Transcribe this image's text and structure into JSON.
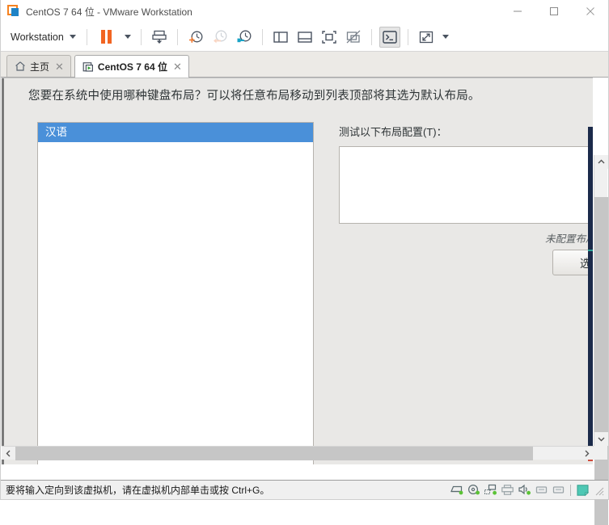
{
  "window": {
    "title": "CentOS 7 64 位 - VMware Workstation",
    "logo_icon": "vmware-logo-icon",
    "minimize_icon": "minimize-icon",
    "maximize_icon": "maximize-icon",
    "close_icon": "close-icon"
  },
  "toolbar": {
    "workstation_menu": "Workstation",
    "workstation_caret_icon": "chevron-down-icon",
    "pause_icon": "pause-icon",
    "pause_caret_icon": "chevron-down-icon",
    "send_ctrl_alt_del_icon": "send-key-icon",
    "take_snapshot_icon": "take-snapshot-icon",
    "revert_snapshot_icon": "revert-snapshot-icon",
    "snapshot_manager_icon": "snapshot-manager-icon",
    "show_sidebar_icon": "show-library-icon",
    "show_thumbnails_icon": "show-thumbnail-bar-icon",
    "fullscreen_icon": "fullscreen-icon",
    "unity_icon": "unity-mode-icon",
    "console_view_icon": "console-view-icon",
    "stretch_icon": "stretch-guest-icon",
    "stretch_caret_icon": "chevron-down-icon"
  },
  "tabs": [
    {
      "label": "主页",
      "icon": "home-icon",
      "close_icon": "close-icon",
      "active": false
    },
    {
      "label": "CentOS 7 64 位",
      "icon": "vm-running-icon",
      "close_icon": "close-icon",
      "active": true
    }
  ],
  "guest": {
    "prompt": "您要在系统中使用哪种键盘布局？可以将任意布局移动到列表顶部将其选为默认布局。",
    "layout_list": [
      {
        "label": "汉语",
        "selected": true
      }
    ],
    "list_buttons": [
      {
        "label": "+",
        "name": "add-layout-button"
      },
      {
        "label": "−",
        "name": "remove-layout-button"
      },
      {
        "label": "⌃",
        "name": "move-layout-up-button"
      },
      {
        "label": "⌄",
        "name": "move-layout-down-button"
      },
      {
        "label": "",
        "name": "preview-keyboard-button",
        "icon": "keyboard-icon"
      }
    ],
    "test_label": "测试以下布局配置(T)：",
    "test_value": "",
    "test_placeholder": "",
    "switch_note": "未配置布局切",
    "options_button": "选项(O"
  },
  "scrollbars": {
    "v_up_icon": "chevron-up-icon",
    "v_down_icon": "chevron-down-icon",
    "h_left_icon": "chevron-left-icon",
    "h_right_icon": "chevron-right-icon"
  },
  "status": {
    "message": "要将输入定向到该虚拟机，请在虚拟机内部单击或按 Ctrl+G。",
    "devices": [
      {
        "name": "hard-disk-icon"
      },
      {
        "name": "cd-dvd-icon"
      },
      {
        "name": "network-adapter-icon"
      },
      {
        "name": "printer-icon"
      },
      {
        "name": "sound-card-icon"
      },
      {
        "name": "usb-device-1-icon"
      },
      {
        "name": "usb-device-2-icon"
      }
    ],
    "message_indicator_icon": "message-log-icon",
    "resize_grip_icon": "resize-grip-icon"
  },
  "colors": {
    "accent_orange": "#f26522",
    "selection_blue": "#4a90d9",
    "device_green": "#5bc236",
    "tab_active_bg": "#ffffff",
    "guest_bg": "#e9e8e6"
  }
}
